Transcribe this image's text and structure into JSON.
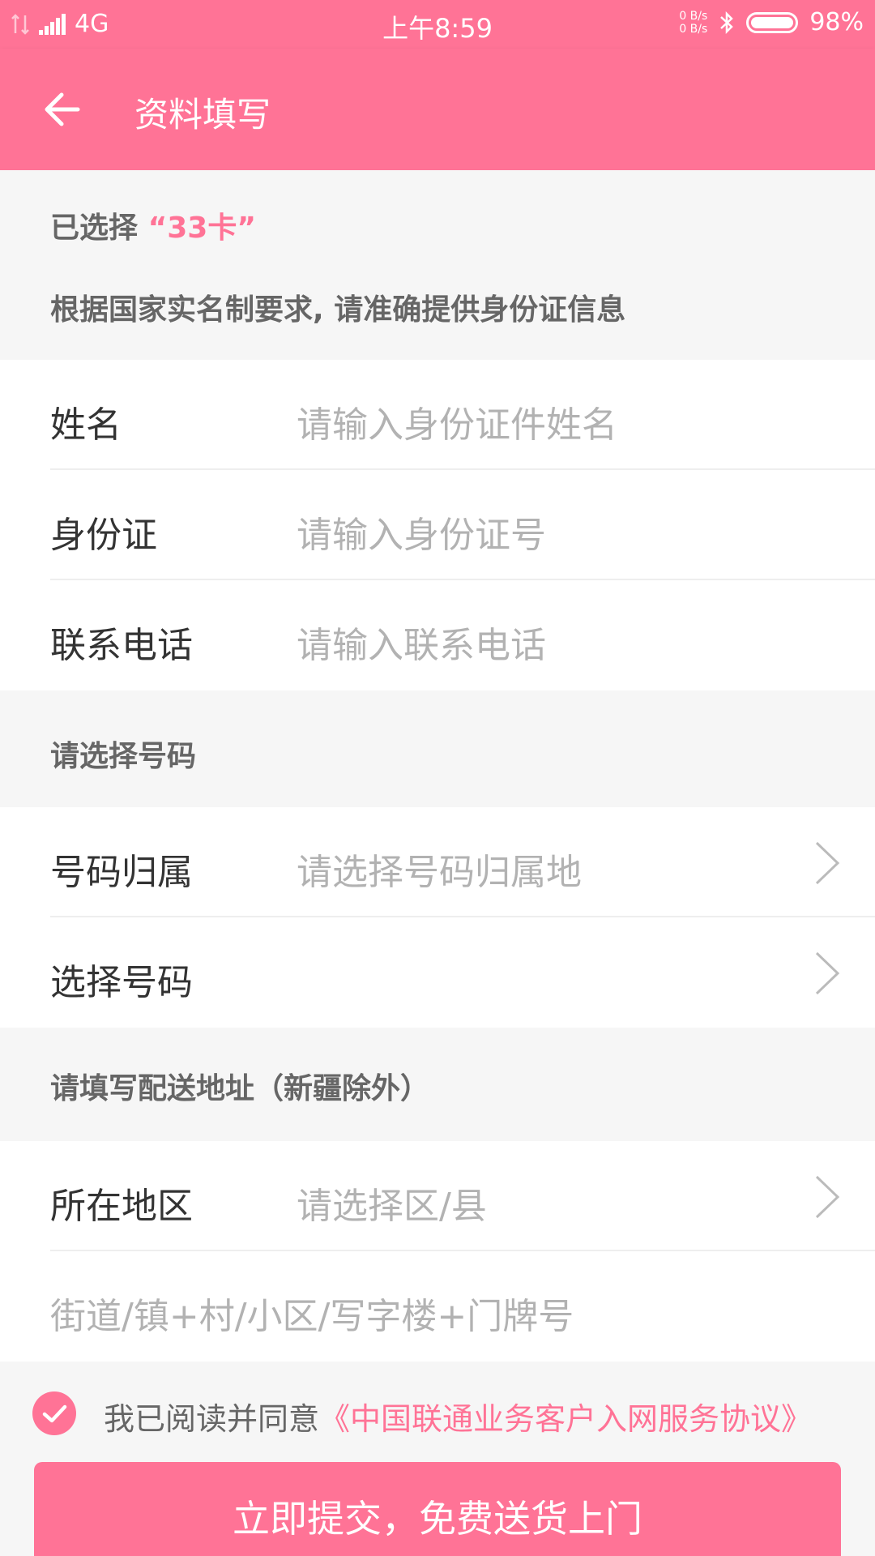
{
  "status_bar": {
    "network": "4G",
    "time": "上午8:59",
    "net_up": "0 B/s",
    "net_down": "0 B/s",
    "battery": "98%"
  },
  "app_bar": {
    "title": "资料填写"
  },
  "selection": {
    "prefix": "已选择",
    "card_name": "“33卡”",
    "notice": "根据国家实名制要求, 请准确提供身份证信息"
  },
  "form": {
    "name": {
      "label": "姓名",
      "placeholder": "请输入身份证件姓名"
    },
    "id_card": {
      "label": "身份证",
      "placeholder": "请输入身份证号"
    },
    "phone": {
      "label": "联系电话",
      "placeholder": "请输入联系电话"
    }
  },
  "number_section": {
    "title": "请选择号码",
    "location": {
      "label": "号码归属",
      "placeholder": "请选择号码归属地"
    },
    "choose": {
      "label": "选择号码"
    }
  },
  "address_section": {
    "title": "请填写配送地址（新疆除外）",
    "region": {
      "label": "所在地区",
      "placeholder": "请选择区/县"
    },
    "street": {
      "placeholder": "街道/镇+村/小区/写字楼+门牌号"
    }
  },
  "agreement": {
    "text": "我已阅读并同意",
    "link": "《中国联通业务客户入网服务协议》"
  },
  "submit": {
    "label": "立即提交，免费送货上门"
  },
  "colors": {
    "accent": "#ff7396",
    "background": "#f6f6f6"
  }
}
